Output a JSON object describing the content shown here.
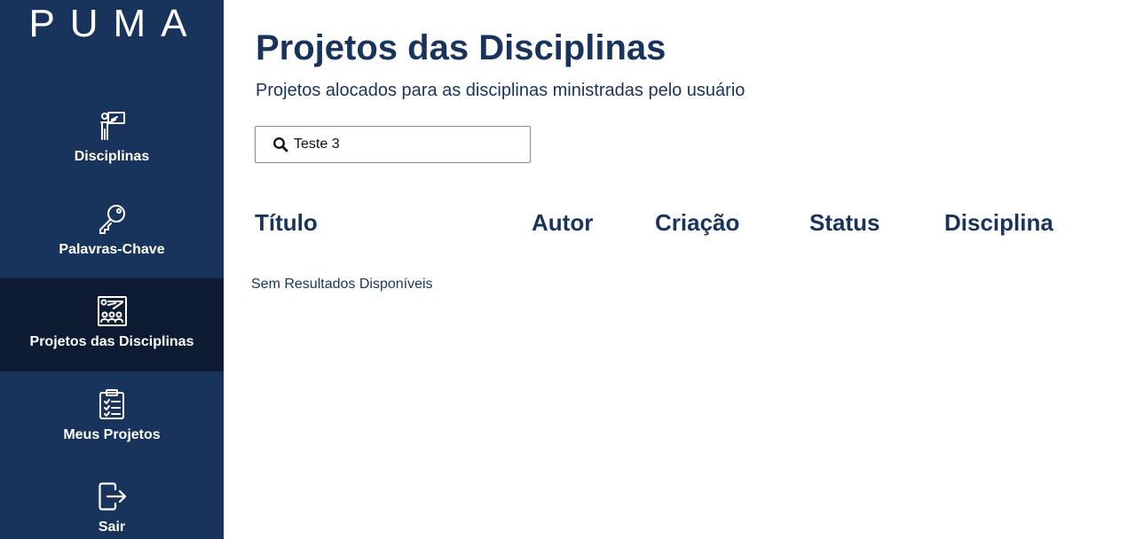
{
  "app": {
    "logo": "PUMA"
  },
  "sidebar": {
    "items": [
      {
        "label": "Disciplinas",
        "icon": "teacher-board-icon"
      },
      {
        "label": "Palavras-Chave",
        "icon": "key-icon"
      },
      {
        "label": "Projetos das Disciplinas",
        "icon": "classroom-icon",
        "active": true
      },
      {
        "label": "Meus Projetos",
        "icon": "clipboard-list-icon"
      },
      {
        "label": "Sair",
        "icon": "logout-icon"
      }
    ]
  },
  "main": {
    "title": "Projetos das Disciplinas",
    "subtitle": "Projetos alocados para as disciplinas ministradas pelo usuário",
    "search": {
      "value": "Teste 3",
      "icon": "search-icon"
    },
    "table": {
      "columns": [
        "Título",
        "Autor",
        "Criação",
        "Status",
        "Disciplina"
      ],
      "rows": []
    },
    "empty_message": "Sem Resultados Disponíveis"
  },
  "colors": {
    "sidebar_bg": "#19345c",
    "sidebar_active_bg": "#0d1c32",
    "text_primary": "#19345c"
  }
}
